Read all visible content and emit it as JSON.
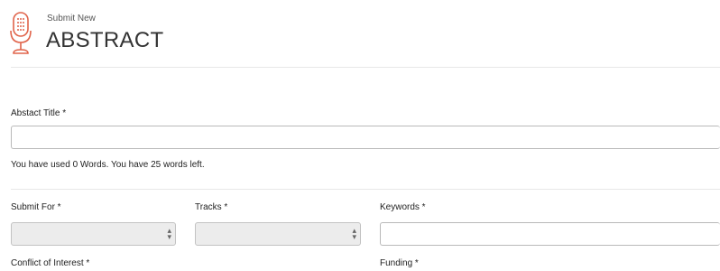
{
  "header": {
    "subtitle": "Submit New",
    "title": "ABSTRACT",
    "icon": "microphone-icon",
    "accent_color": "#e0634a"
  },
  "form": {
    "abstract_title": {
      "label": "Abstact Title *",
      "value": "",
      "help": "You have used 0 Words. You have 25 words left."
    },
    "submit_for": {
      "label": "Submit For *",
      "value": ""
    },
    "tracks": {
      "label": "Tracks *",
      "value": ""
    },
    "keywords": {
      "label": "Keywords *",
      "value": ""
    },
    "conflict_of_interest": {
      "label": "Conflict of Interest *"
    },
    "funding": {
      "label": "Funding *"
    }
  }
}
